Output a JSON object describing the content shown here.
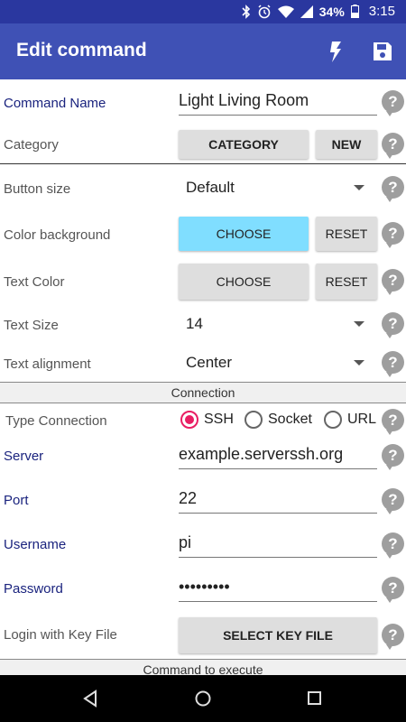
{
  "status": {
    "battery": "34%",
    "time": "3:15"
  },
  "appbar": {
    "title": "Edit command"
  },
  "form": {
    "command_name": {
      "label": "Command Name",
      "value": "Light Living Room"
    },
    "category": {
      "label": "Category",
      "button": "CATEGORY",
      "new_button": "NEW"
    },
    "button_size": {
      "label": "Button size",
      "value": "Default"
    },
    "color_background": {
      "label": "Color background",
      "choose": "CHOOSE",
      "reset": "RESET"
    },
    "text_color": {
      "label": "Text Color",
      "choose": "CHOOSE",
      "reset": "RESET"
    },
    "text_size": {
      "label": "Text Size",
      "value": "14"
    },
    "text_alignment": {
      "label": "Text alignment",
      "value": "Center"
    },
    "connection_header": "Connection",
    "type_connection": {
      "label": "Type Connection",
      "options": [
        "SSH",
        "Socket",
        "URL"
      ],
      "selected": "SSH"
    },
    "server": {
      "label": "Server",
      "value": "example.serverssh.org"
    },
    "port": {
      "label": "Port",
      "value": "22"
    },
    "username": {
      "label": "Username",
      "value": "pi"
    },
    "password": {
      "label": "Password",
      "value": "•••••••••"
    },
    "key_file": {
      "label": "Login with Key File",
      "button": "SELECT KEY FILE"
    },
    "command_header": "Command to execute"
  },
  "help_glyph": "?",
  "colors": {
    "primary": "#3f51b5",
    "primary_dark": "#2a379f",
    "accent": "#e91e63",
    "highlight_button": "#80deff"
  }
}
